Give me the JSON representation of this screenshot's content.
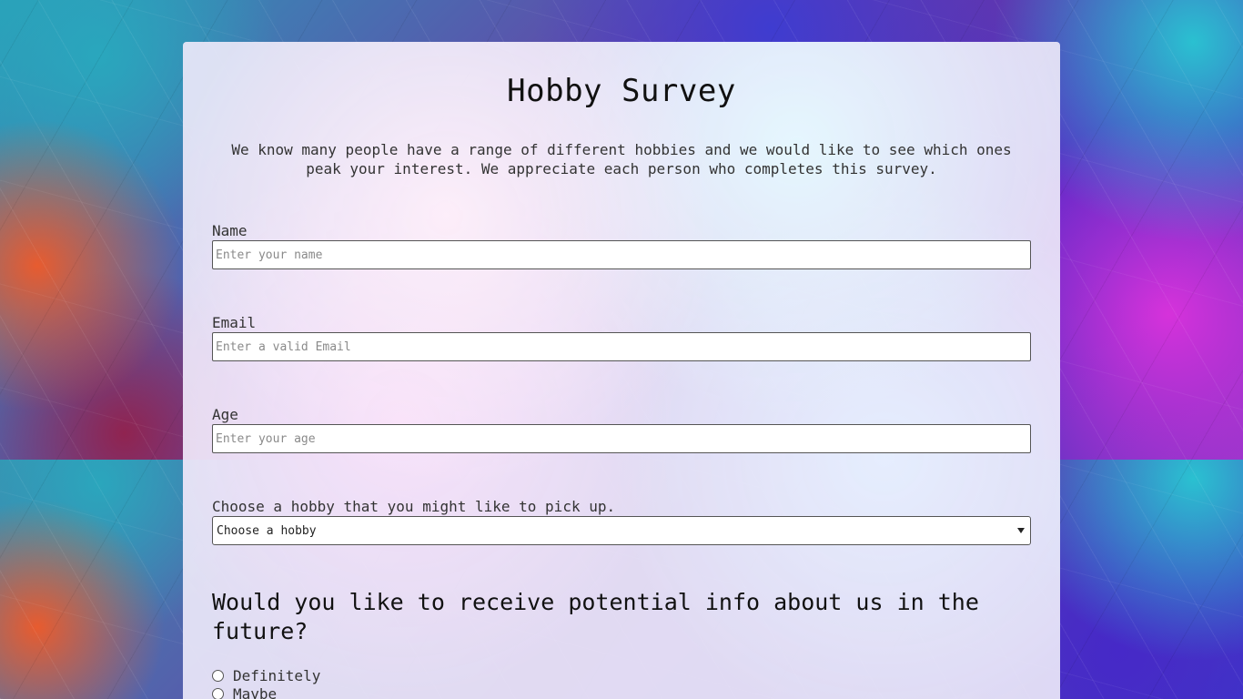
{
  "survey": {
    "title": "Hobby Survey",
    "description": "We know many people have a range of different hobbies and we would like to see which ones peak your interest. We appreciate each person who completes this survey."
  },
  "fields": {
    "name": {
      "label": "Name",
      "placeholder": "Enter your name",
      "value": ""
    },
    "email": {
      "label": "Email",
      "placeholder": "Enter a valid Email",
      "value": ""
    },
    "age": {
      "label": "Age",
      "placeholder": "Enter your age",
      "value": ""
    }
  },
  "hobby_select": {
    "label": "Choose a hobby that you might like to pick up.",
    "selected": "Choose a hobby"
  },
  "contact_question": {
    "text": "Would you like to receive potential info about us in the future?",
    "options": [
      "Definitely",
      "Maybe"
    ]
  },
  "icons": {
    "select": "chevron-down-icon",
    "radio": "radio-unchecked-icon"
  }
}
